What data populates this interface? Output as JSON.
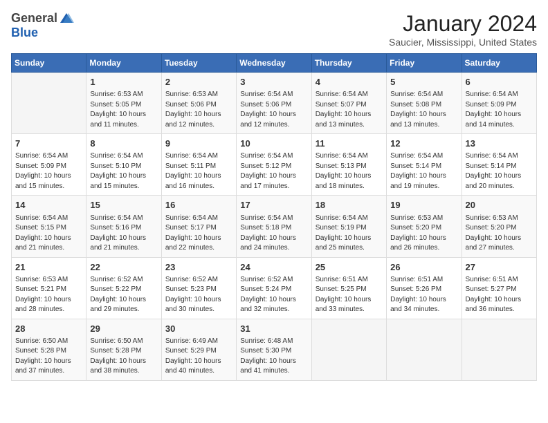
{
  "header": {
    "logo_general": "General",
    "logo_blue": "Blue",
    "title": "January 2024",
    "subtitle": "Saucier, Mississippi, United States"
  },
  "days_of_week": [
    "Sunday",
    "Monday",
    "Tuesday",
    "Wednesday",
    "Thursday",
    "Friday",
    "Saturday"
  ],
  "weeks": [
    [
      {
        "day": "",
        "info": ""
      },
      {
        "day": "1",
        "info": "Sunrise: 6:53 AM\nSunset: 5:05 PM\nDaylight: 10 hours\nand 11 minutes."
      },
      {
        "day": "2",
        "info": "Sunrise: 6:53 AM\nSunset: 5:06 PM\nDaylight: 10 hours\nand 12 minutes."
      },
      {
        "day": "3",
        "info": "Sunrise: 6:54 AM\nSunset: 5:06 PM\nDaylight: 10 hours\nand 12 minutes."
      },
      {
        "day": "4",
        "info": "Sunrise: 6:54 AM\nSunset: 5:07 PM\nDaylight: 10 hours\nand 13 minutes."
      },
      {
        "day": "5",
        "info": "Sunrise: 6:54 AM\nSunset: 5:08 PM\nDaylight: 10 hours\nand 13 minutes."
      },
      {
        "day": "6",
        "info": "Sunrise: 6:54 AM\nSunset: 5:09 PM\nDaylight: 10 hours\nand 14 minutes."
      }
    ],
    [
      {
        "day": "7",
        "info": "Sunrise: 6:54 AM\nSunset: 5:09 PM\nDaylight: 10 hours\nand 15 minutes."
      },
      {
        "day": "8",
        "info": "Sunrise: 6:54 AM\nSunset: 5:10 PM\nDaylight: 10 hours\nand 15 minutes."
      },
      {
        "day": "9",
        "info": "Sunrise: 6:54 AM\nSunset: 5:11 PM\nDaylight: 10 hours\nand 16 minutes."
      },
      {
        "day": "10",
        "info": "Sunrise: 6:54 AM\nSunset: 5:12 PM\nDaylight: 10 hours\nand 17 minutes."
      },
      {
        "day": "11",
        "info": "Sunrise: 6:54 AM\nSunset: 5:13 PM\nDaylight: 10 hours\nand 18 minutes."
      },
      {
        "day": "12",
        "info": "Sunrise: 6:54 AM\nSunset: 5:14 PM\nDaylight: 10 hours\nand 19 minutes."
      },
      {
        "day": "13",
        "info": "Sunrise: 6:54 AM\nSunset: 5:14 PM\nDaylight: 10 hours\nand 20 minutes."
      }
    ],
    [
      {
        "day": "14",
        "info": "Sunrise: 6:54 AM\nSunset: 5:15 PM\nDaylight: 10 hours\nand 21 minutes."
      },
      {
        "day": "15",
        "info": "Sunrise: 6:54 AM\nSunset: 5:16 PM\nDaylight: 10 hours\nand 21 minutes."
      },
      {
        "day": "16",
        "info": "Sunrise: 6:54 AM\nSunset: 5:17 PM\nDaylight: 10 hours\nand 22 minutes."
      },
      {
        "day": "17",
        "info": "Sunrise: 6:54 AM\nSunset: 5:18 PM\nDaylight: 10 hours\nand 24 minutes."
      },
      {
        "day": "18",
        "info": "Sunrise: 6:54 AM\nSunset: 5:19 PM\nDaylight: 10 hours\nand 25 minutes."
      },
      {
        "day": "19",
        "info": "Sunrise: 6:53 AM\nSunset: 5:20 PM\nDaylight: 10 hours\nand 26 minutes."
      },
      {
        "day": "20",
        "info": "Sunrise: 6:53 AM\nSunset: 5:20 PM\nDaylight: 10 hours\nand 27 minutes."
      }
    ],
    [
      {
        "day": "21",
        "info": "Sunrise: 6:53 AM\nSunset: 5:21 PM\nDaylight: 10 hours\nand 28 minutes."
      },
      {
        "day": "22",
        "info": "Sunrise: 6:52 AM\nSunset: 5:22 PM\nDaylight: 10 hours\nand 29 minutes."
      },
      {
        "day": "23",
        "info": "Sunrise: 6:52 AM\nSunset: 5:23 PM\nDaylight: 10 hours\nand 30 minutes."
      },
      {
        "day": "24",
        "info": "Sunrise: 6:52 AM\nSunset: 5:24 PM\nDaylight: 10 hours\nand 32 minutes."
      },
      {
        "day": "25",
        "info": "Sunrise: 6:51 AM\nSunset: 5:25 PM\nDaylight: 10 hours\nand 33 minutes."
      },
      {
        "day": "26",
        "info": "Sunrise: 6:51 AM\nSunset: 5:26 PM\nDaylight: 10 hours\nand 34 minutes."
      },
      {
        "day": "27",
        "info": "Sunrise: 6:51 AM\nSunset: 5:27 PM\nDaylight: 10 hours\nand 36 minutes."
      }
    ],
    [
      {
        "day": "28",
        "info": "Sunrise: 6:50 AM\nSunset: 5:28 PM\nDaylight: 10 hours\nand 37 minutes."
      },
      {
        "day": "29",
        "info": "Sunrise: 6:50 AM\nSunset: 5:28 PM\nDaylight: 10 hours\nand 38 minutes."
      },
      {
        "day": "30",
        "info": "Sunrise: 6:49 AM\nSunset: 5:29 PM\nDaylight: 10 hours\nand 40 minutes."
      },
      {
        "day": "31",
        "info": "Sunrise: 6:48 AM\nSunset: 5:30 PM\nDaylight: 10 hours\nand 41 minutes."
      },
      {
        "day": "",
        "info": ""
      },
      {
        "day": "",
        "info": ""
      },
      {
        "day": "",
        "info": ""
      }
    ]
  ]
}
